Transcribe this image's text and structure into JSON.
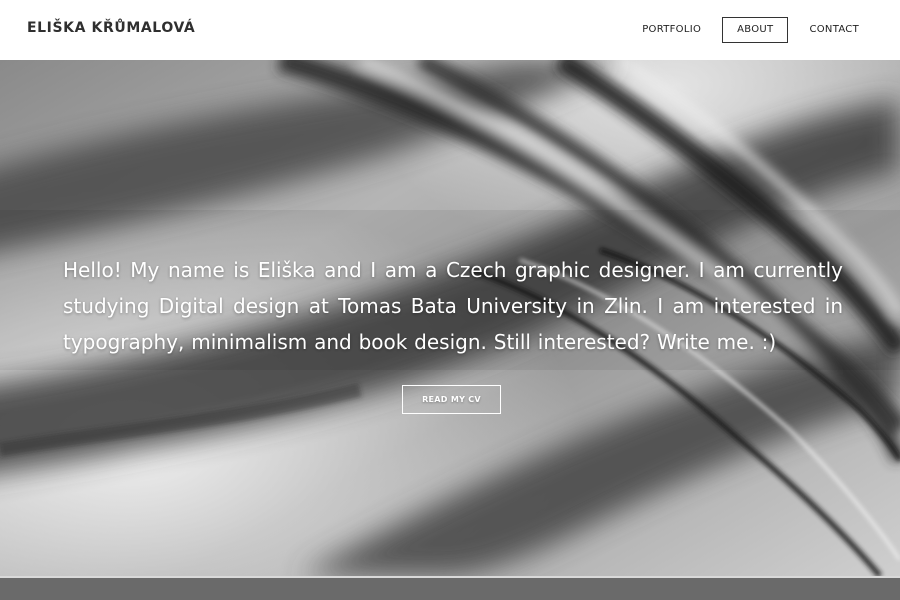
{
  "header": {
    "brand": "ELIŠKA KŘŮMALOVÁ",
    "nav": [
      {
        "label": "PORTFOLIO",
        "active": false
      },
      {
        "label": "ABOUT",
        "active": true
      },
      {
        "label": "CONTACT",
        "active": false
      }
    ]
  },
  "hero": {
    "intro_text": "Hello! My name is Eliška and I am a Czech graphic designer. I am currently studying Digital design at Tomas Bata University in Zlin. I am interested in typography, minimalism and book design. Still interested? Write me. :)",
    "cv_button_label": "READ MY CV",
    "background": "grayscale-blurred-book-pages"
  },
  "colors": {
    "header_bg": "#ffffff",
    "text_dark": "#2f2f2f",
    "hero_text": "#ffffff",
    "footer_strip": "#6a6a6a"
  }
}
